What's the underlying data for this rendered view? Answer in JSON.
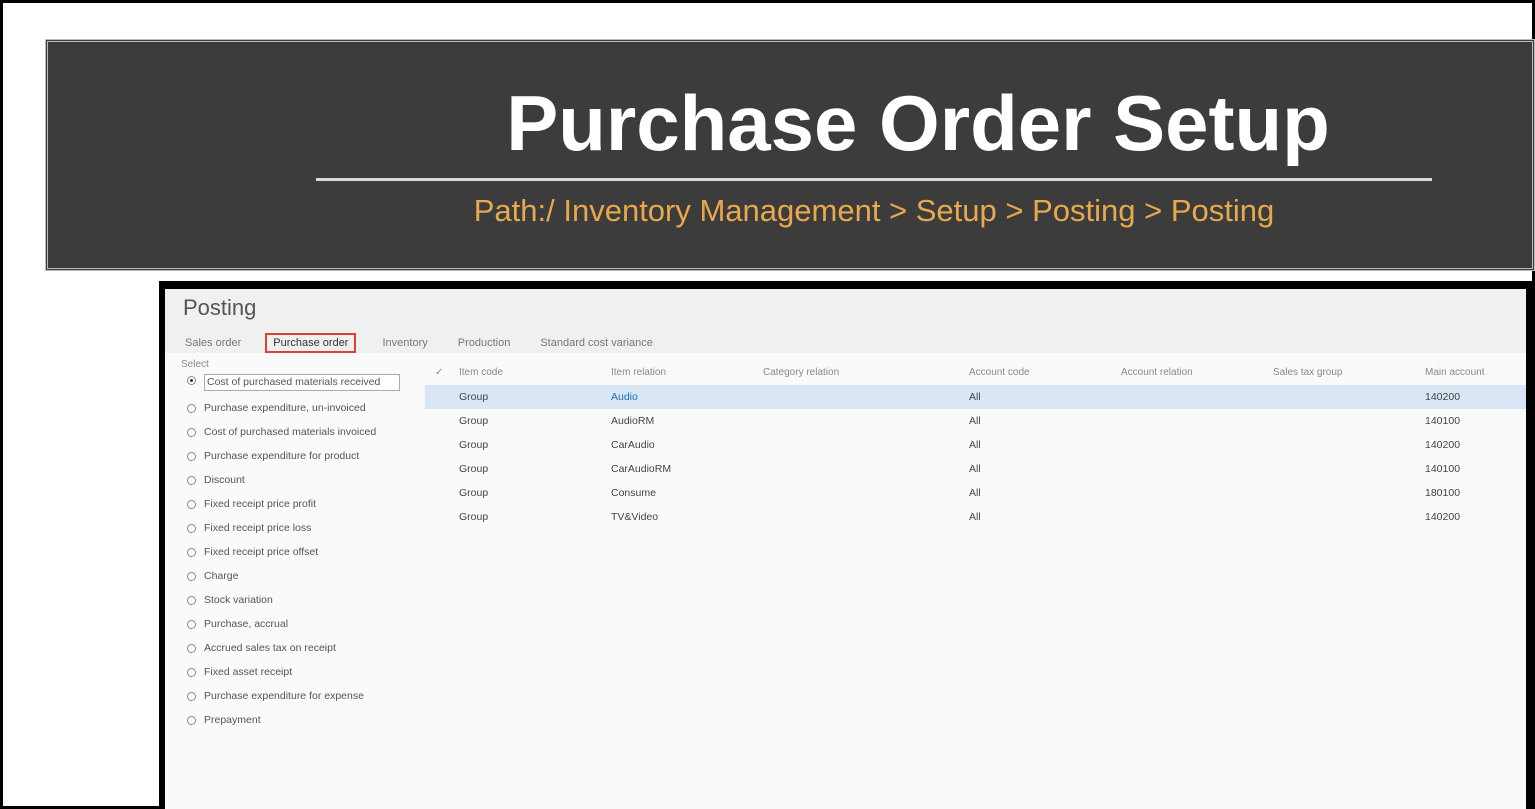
{
  "banner": {
    "title": "Purchase Order Setup",
    "path": "Path:/ Inventory Management > Setup > Posting > Posting"
  },
  "app": {
    "title": "Posting",
    "tabs": [
      "Sales order",
      "Purchase order",
      "Inventory",
      "Production",
      "Standard cost variance"
    ],
    "active_tab": "Purchase order"
  },
  "select": {
    "label": "Select",
    "options": [
      "Cost of purchased materials received",
      "Purchase expenditure, un-invoiced",
      "Cost of purchased materials invoiced",
      "Purchase expenditure for product",
      "Discount",
      "Fixed receipt price profit",
      "Fixed receipt price loss",
      "Fixed receipt price offset",
      "Charge",
      "Stock variation",
      "Purchase, accrual",
      "Accrued sales tax on receipt",
      "Fixed asset receipt",
      "Purchase expenditure for expense",
      "Prepayment"
    ],
    "selected_index": 0
  },
  "grid": {
    "check": "✓",
    "columns": [
      "Item code",
      "Item relation",
      "Category relation",
      "Account code",
      "Account relation",
      "Sales tax group",
      "Main account"
    ],
    "rows": [
      {
        "item_code": "Group",
        "item_relation": "Audio",
        "category_relation": "",
        "account_code": "All",
        "account_relation": "",
        "sales_tax_group": "",
        "main_account": "140200"
      },
      {
        "item_code": "Group",
        "item_relation": "AudioRM",
        "category_relation": "",
        "account_code": "All",
        "account_relation": "",
        "sales_tax_group": "",
        "main_account": "140100"
      },
      {
        "item_code": "Group",
        "item_relation": "CarAudio",
        "category_relation": "",
        "account_code": "All",
        "account_relation": "",
        "sales_tax_group": "",
        "main_account": "140200"
      },
      {
        "item_code": "Group",
        "item_relation": "CarAudioRM",
        "category_relation": "",
        "account_code": "All",
        "account_relation": "",
        "sales_tax_group": "",
        "main_account": "140100"
      },
      {
        "item_code": "Group",
        "item_relation": "Consume",
        "category_relation": "",
        "account_code": "All",
        "account_relation": "",
        "sales_tax_group": "",
        "main_account": "180100"
      },
      {
        "item_code": "Group",
        "item_relation": "TV&Video",
        "category_relation": "",
        "account_code": "All",
        "account_relation": "",
        "sales_tax_group": "",
        "main_account": "140200"
      }
    ],
    "selected_row": 0
  }
}
